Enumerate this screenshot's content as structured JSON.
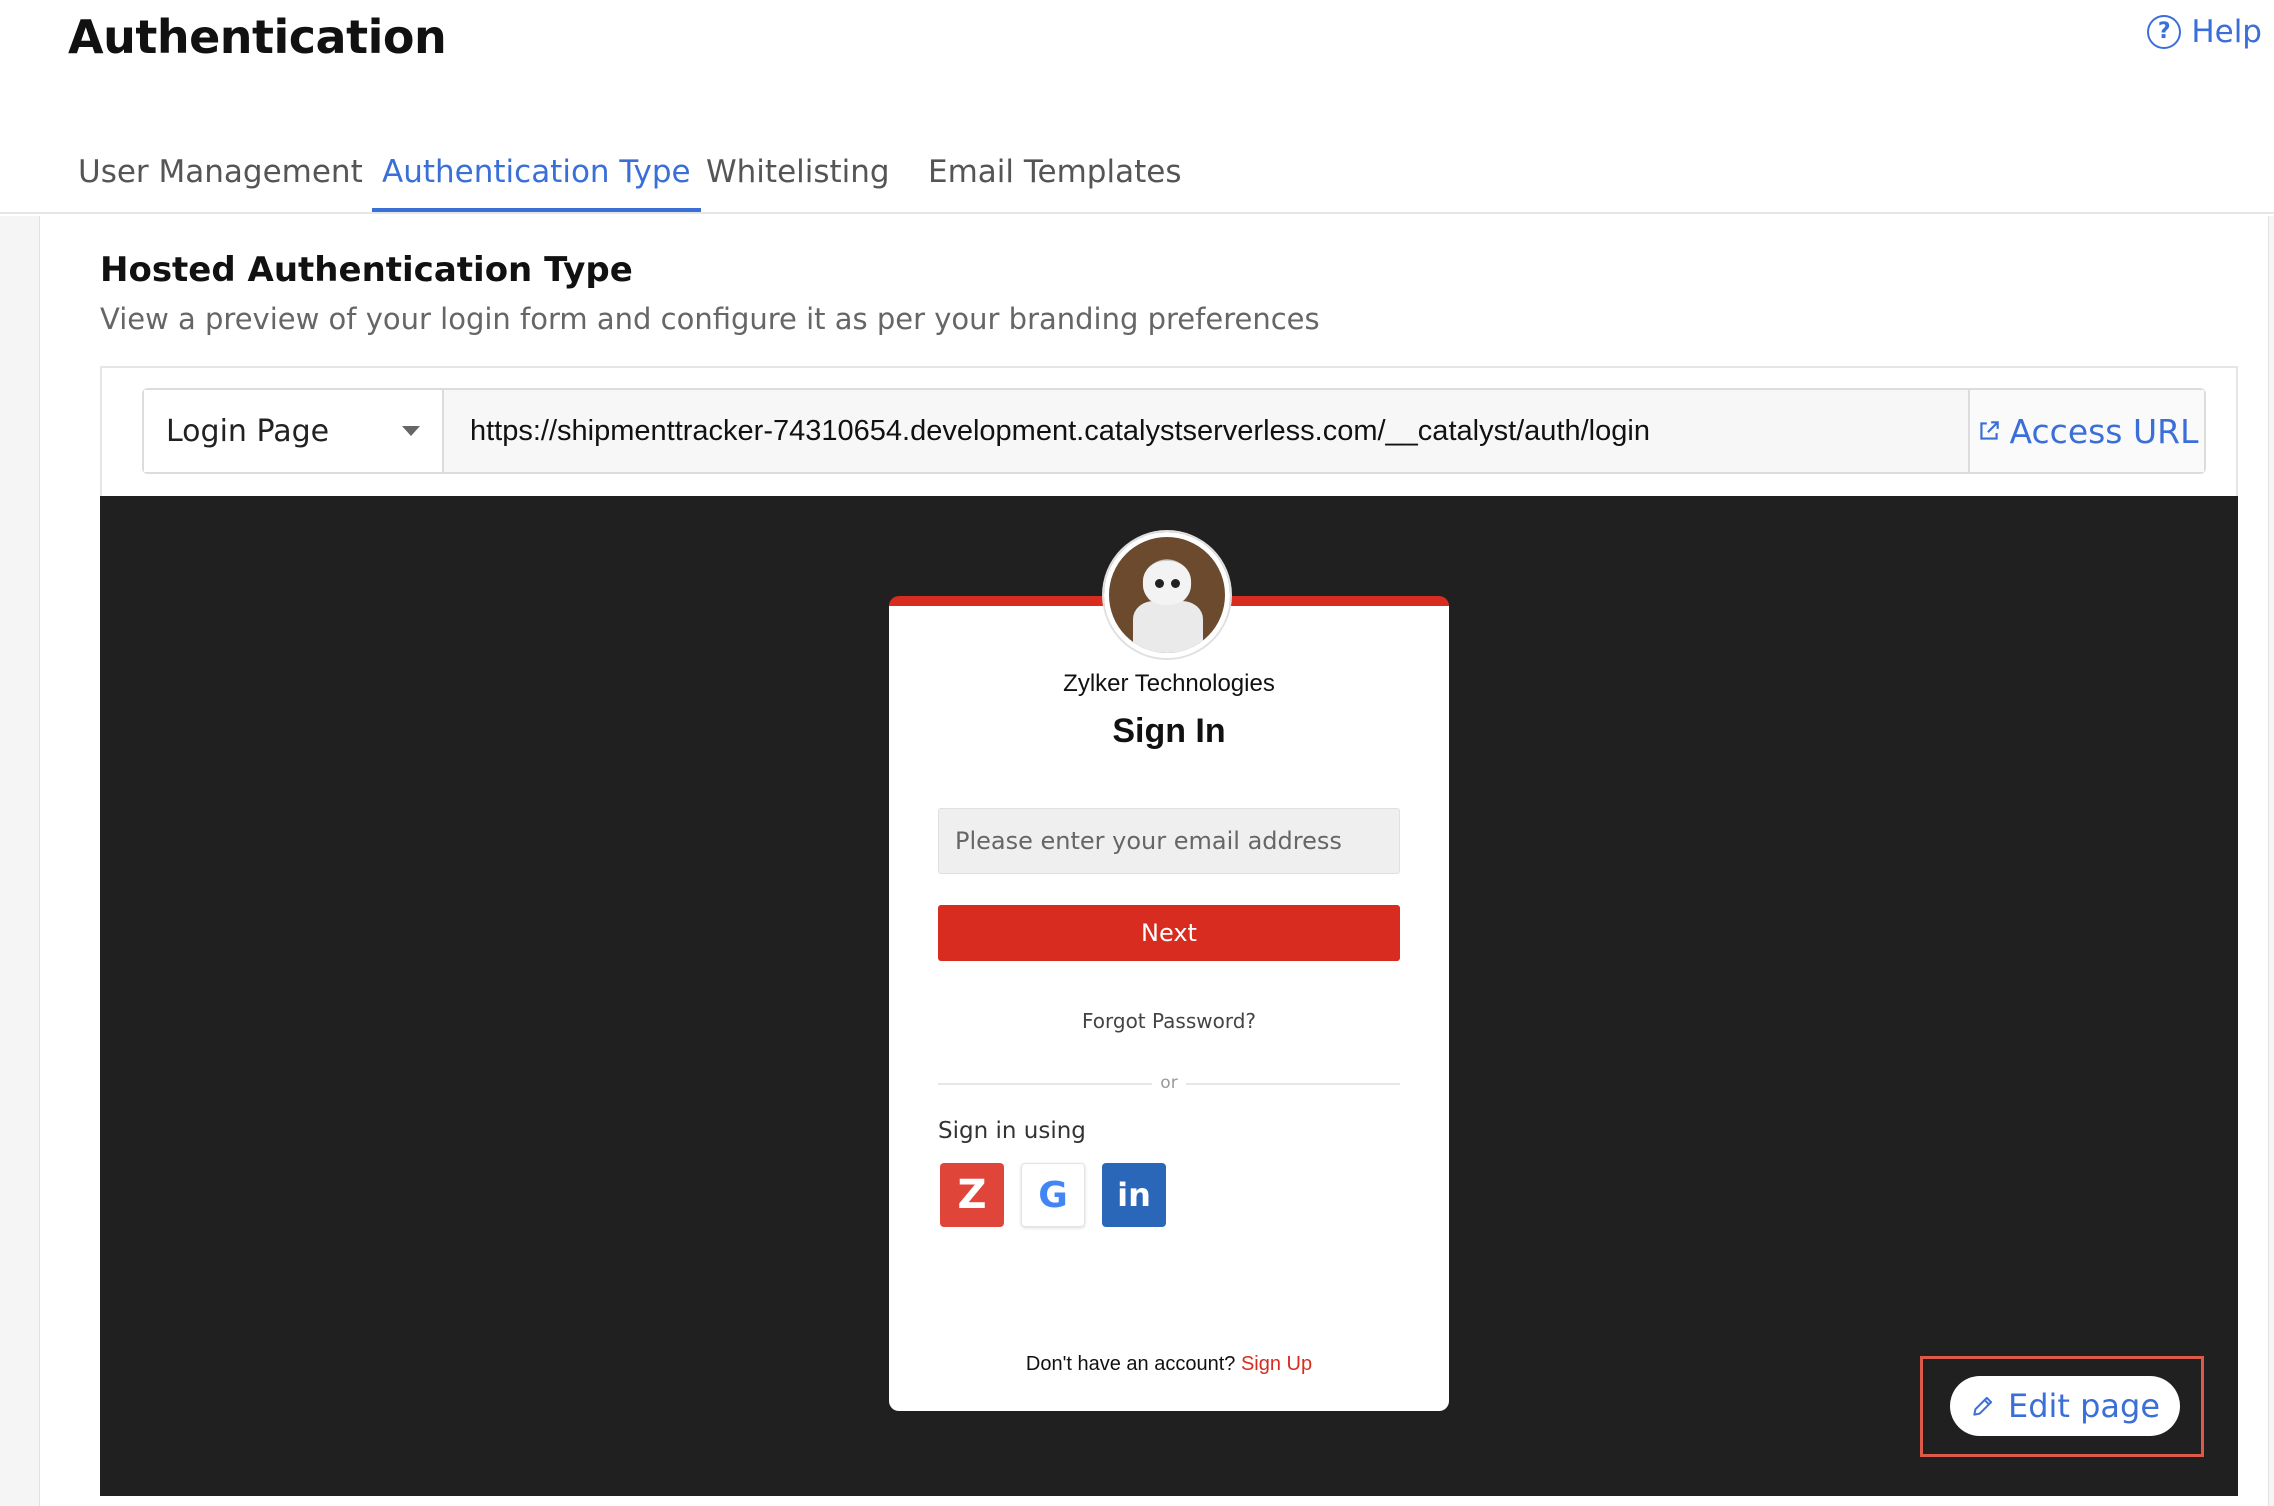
{
  "header": {
    "title": "Authentication",
    "help_label": "Help",
    "help_icon": "?"
  },
  "tabs": [
    {
      "label": "User Management",
      "active": false
    },
    {
      "label": "Authentication Type",
      "active": true
    },
    {
      "label": "Whitelisting",
      "active": false
    },
    {
      "label": "Email Templates",
      "active": false
    }
  ],
  "section": {
    "title": "Hosted Authentication Type",
    "description": "View a preview of your login form and configure it as per your branding preferences"
  },
  "url_bar": {
    "page_select_value": "Login Page",
    "url": "https://shipmenttracker-74310654.development.catalystserverless.com/__catalyst/auth/login",
    "access_label": "Access URL"
  },
  "login_preview": {
    "company_name": "Zylker Technologies",
    "heading": "Sign In",
    "email_placeholder": "Please enter your email address",
    "next_label": "Next",
    "forgot_label": "Forgot Password?",
    "divider_label": "or",
    "sign_in_using_label": "Sign in using",
    "social": {
      "zoho_glyph": "Z",
      "google_glyph": "G",
      "linkedin_glyph": "in"
    },
    "no_account_label": "Don't have an account?",
    "signup_label": "Sign Up",
    "accent_color": "#d82c20"
  },
  "edit_button": {
    "label": "Edit page"
  },
  "colors": {
    "link_blue": "#3b6fd8",
    "preview_bg": "#202020",
    "highlight": "#dd5a49"
  }
}
